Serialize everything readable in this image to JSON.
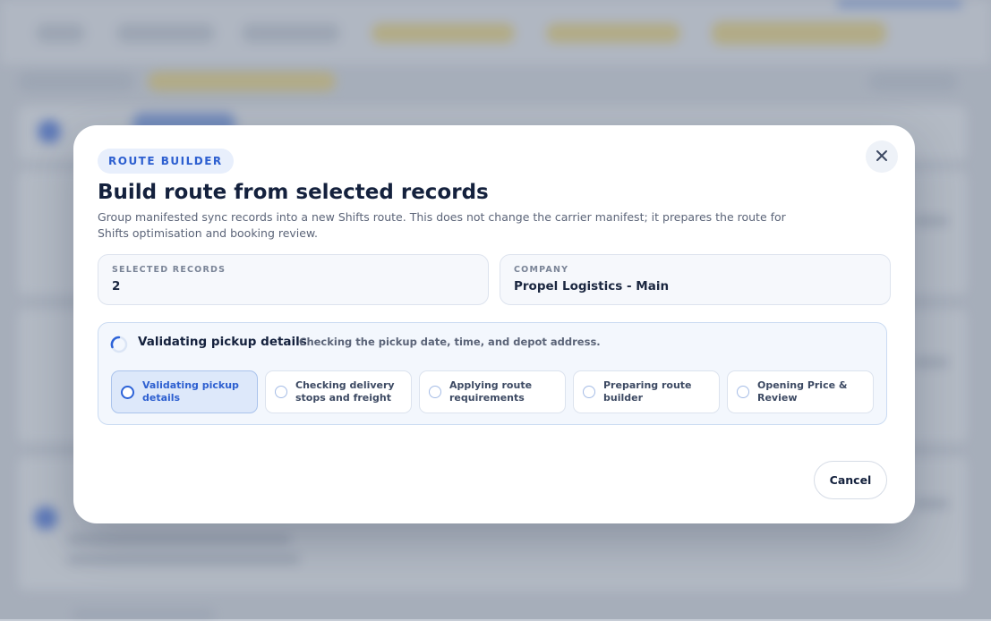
{
  "modal": {
    "tag": "ROUTE BUILDER",
    "title": "Build route from selected records",
    "description": "Group manifested sync records into a new Shifts route. This does not change the carrier manifest; it prepares the route for Shifts optimisation and booking review.",
    "selected_records": {
      "label": "SELECTED RECORDS",
      "value": "2"
    },
    "company": {
      "label": "COMPANY",
      "value": "Propel Logistics - Main"
    },
    "progress": {
      "title": "Validating pickup details",
      "subtitle": "Checking the pickup date, time, and depot address.",
      "steps": [
        {
          "label": "Validating pickup details",
          "state": "active"
        },
        {
          "label": "Checking delivery stops and freight",
          "state": "pending"
        },
        {
          "label": "Applying route requirements",
          "state": "pending"
        },
        {
          "label": "Preparing route builder",
          "state": "pending"
        },
        {
          "label": "Opening Price & Review",
          "state": "pending"
        }
      ]
    },
    "cancel_label": "Cancel",
    "close_icon": "close-icon"
  },
  "colors": {
    "accent": "#2d5fd0",
    "title": "#14213d",
    "tag_bg": "#e8effc",
    "progress_bg": "#f3f7fd"
  }
}
